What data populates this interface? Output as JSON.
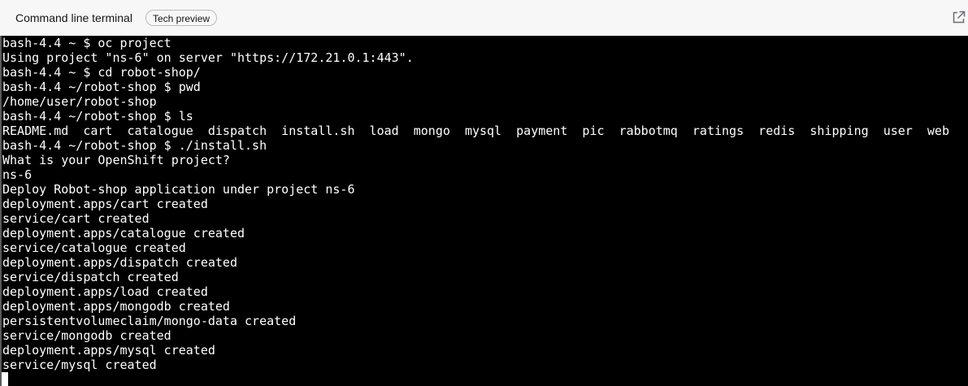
{
  "header": {
    "title": "Command line terminal",
    "badge": "Tech preview",
    "expand_icon": "external-link-icon"
  },
  "terminal": {
    "lines": [
      "bash-4.4 ~ $ oc project",
      "Using project \"ns-6\" on server \"https://172.21.0.1:443\".",
      "bash-4.4 ~ $ cd robot-shop/",
      "bash-4.4 ~/robot-shop $ pwd",
      "/home/user/robot-shop",
      "bash-4.4 ~/robot-shop $ ls",
      "README.md  cart  catalogue  dispatch  install.sh  load  mongo  mysql  payment  pic  rabbotmq  ratings  redis  shipping  user  web",
      "bash-4.4 ~/robot-shop $ ./install.sh",
      "What is your OpenShift project?",
      "ns-6",
      "Deploy Robot-shop application under project ns-6",
      "deployment.apps/cart created",
      "service/cart created",
      "deployment.apps/catalogue created",
      "service/catalogue created",
      "deployment.apps/dispatch created",
      "service/dispatch created",
      "deployment.apps/load created",
      "deployment.apps/mongodb created",
      "persistentvolumeclaim/mongo-data created",
      "service/mongodb created",
      "deployment.apps/mysql created",
      "service/mysql created"
    ]
  }
}
